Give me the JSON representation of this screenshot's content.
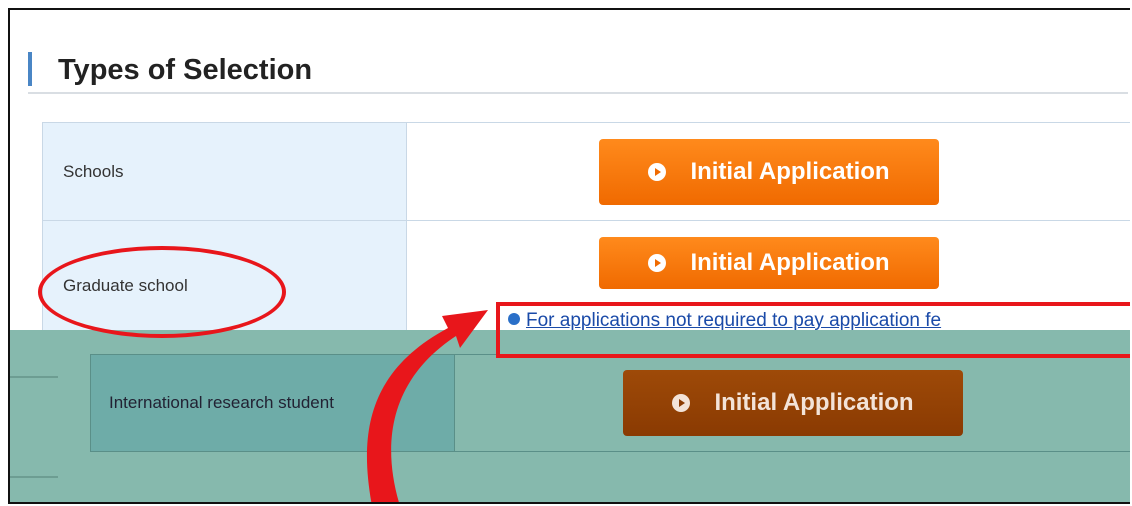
{
  "section": {
    "title": "Types of Selection"
  },
  "rows": [
    {
      "label": "Schools",
      "button": "Initial Application"
    },
    {
      "label": "Graduate school",
      "button": "Initial Application",
      "link": "For applications not required to pay application fe"
    }
  ],
  "overlay_row": {
    "label": "International research student",
    "button": "Initial Application"
  },
  "colors": {
    "accent": "#f06a00",
    "highlight": "#e8161b",
    "label_bg": "#e6f2fc",
    "overlay_bg": "#86b9ad"
  }
}
